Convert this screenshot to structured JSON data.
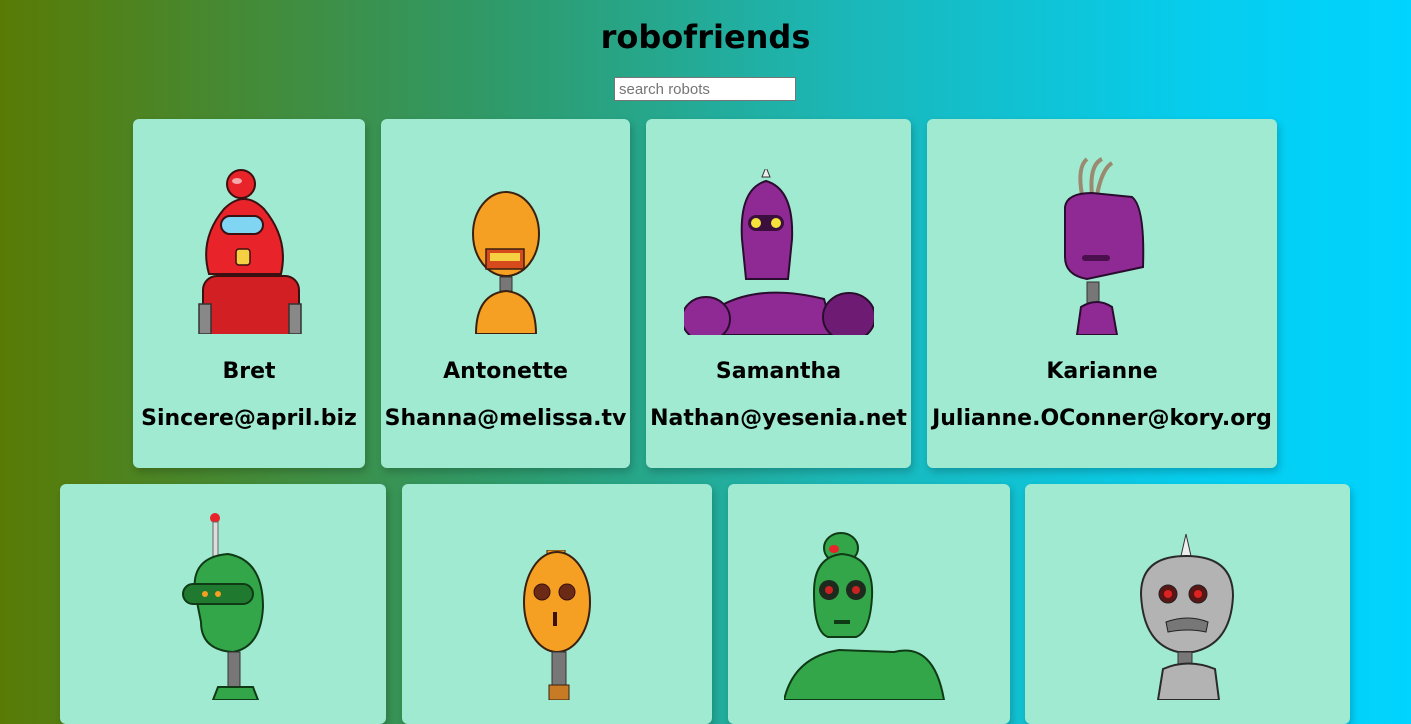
{
  "app": {
    "title": "robofriends"
  },
  "search": {
    "placeholder": "search robots",
    "value": ""
  },
  "robots": [
    {
      "name": "Bret",
      "email": "Sincere@april.biz"
    },
    {
      "name": "Antonette",
      "email": "Shanna@melissa.tv"
    },
    {
      "name": "Samantha",
      "email": "Nathan@yesenia.net"
    },
    {
      "name": "Karianne",
      "email": "Julianne.OConner@kory.org"
    },
    {
      "name": "",
      "email": ""
    },
    {
      "name": "",
      "email": ""
    },
    {
      "name": "",
      "email": ""
    },
    {
      "name": "",
      "email": ""
    }
  ],
  "colors": {
    "card": "#a0ead1",
    "gradient_start": "#597b05",
    "gradient_end": "#00d4ff"
  }
}
